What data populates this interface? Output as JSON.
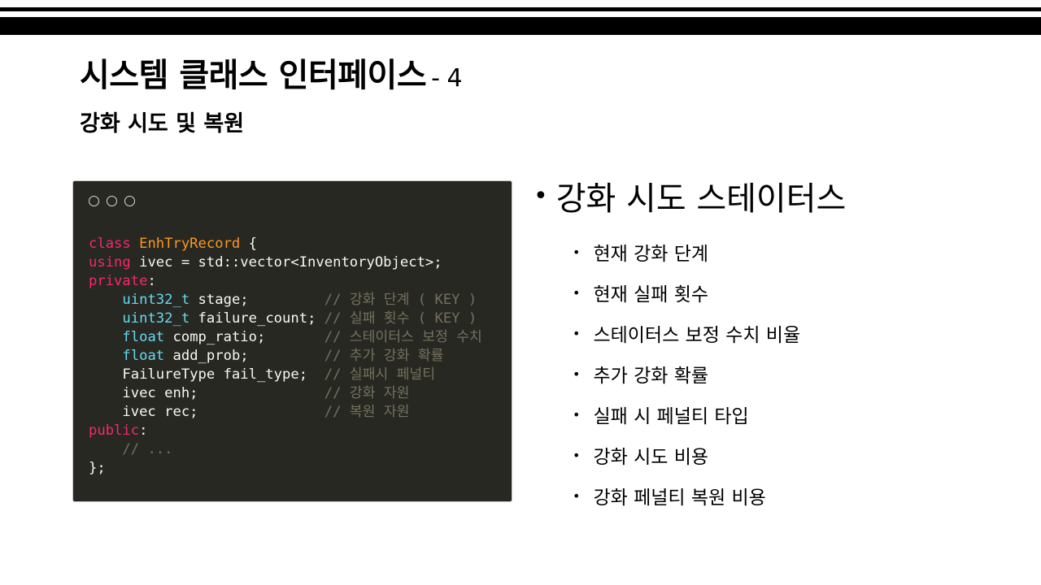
{
  "slide": {
    "title": "시스템 클래스 인터페이스",
    "title_suffix": "- 4",
    "subtitle": "강화 시도 및 복원"
  },
  "code_window": {
    "lines": [
      [
        {
          "t": "class ",
          "c": "kw"
        },
        {
          "t": "EnhTryRecord",
          "c": "cls"
        },
        {
          "t": " {",
          "c": ""
        }
      ],
      [
        {
          "t": "using",
          "c": "kw"
        },
        {
          "t": " ivec = std::vector<InventoryObject>;",
          "c": ""
        }
      ],
      [
        {
          "t": "private",
          "c": "kw"
        },
        {
          "t": ":",
          "c": ""
        }
      ],
      [
        {
          "t": "    ",
          "c": ""
        },
        {
          "t": "uint32_t",
          "c": "ty"
        },
        {
          "t": " stage;         ",
          "c": ""
        },
        {
          "t": "// 강화 단계 ( KEY )",
          "c": "cm"
        }
      ],
      [
        {
          "t": "    ",
          "c": ""
        },
        {
          "t": "uint32_t",
          "c": "ty"
        },
        {
          "t": " failure_count; ",
          "c": ""
        },
        {
          "t": "// 실패 횟수 ( KEY )",
          "c": "cm"
        }
      ],
      [
        {
          "t": "    ",
          "c": ""
        },
        {
          "t": "float",
          "c": "ty"
        },
        {
          "t": " comp_ratio;       ",
          "c": ""
        },
        {
          "t": "// 스테이터스 보정 수치",
          "c": "cm"
        }
      ],
      [
        {
          "t": "    ",
          "c": ""
        },
        {
          "t": "float",
          "c": "ty"
        },
        {
          "t": " add_prob;         ",
          "c": ""
        },
        {
          "t": "// 추가 강화 확률",
          "c": "cm"
        }
      ],
      [
        {
          "t": "    FailureType fail_type;  ",
          "c": ""
        },
        {
          "t": "// 실패시 페널티",
          "c": "cm"
        }
      ],
      [
        {
          "t": "    ivec enh;               ",
          "c": ""
        },
        {
          "t": "// 강화 자원",
          "c": "cm"
        }
      ],
      [
        {
          "t": "    ivec rec;               ",
          "c": ""
        },
        {
          "t": "// 복원 자원",
          "c": "cm"
        }
      ],
      [
        {
          "t": "public",
          "c": "kw"
        },
        {
          "t": ":",
          "c": ""
        }
      ],
      [
        {
          "t": "    ",
          "c": ""
        },
        {
          "t": "// ...",
          "c": "cm"
        }
      ],
      [
        {
          "t": "};",
          "c": ""
        }
      ]
    ]
  },
  "bullets": {
    "main": "강화 시도 스테이터스",
    "items": [
      "현재 강화 단계",
      "현재 실패 횟수",
      "스테이터스 보정 수치 비율",
      "추가 강화 확률",
      "실패 시 페널티 타입",
      "강화 시도 비용",
      "강화 페널티 복원 비용"
    ]
  }
}
